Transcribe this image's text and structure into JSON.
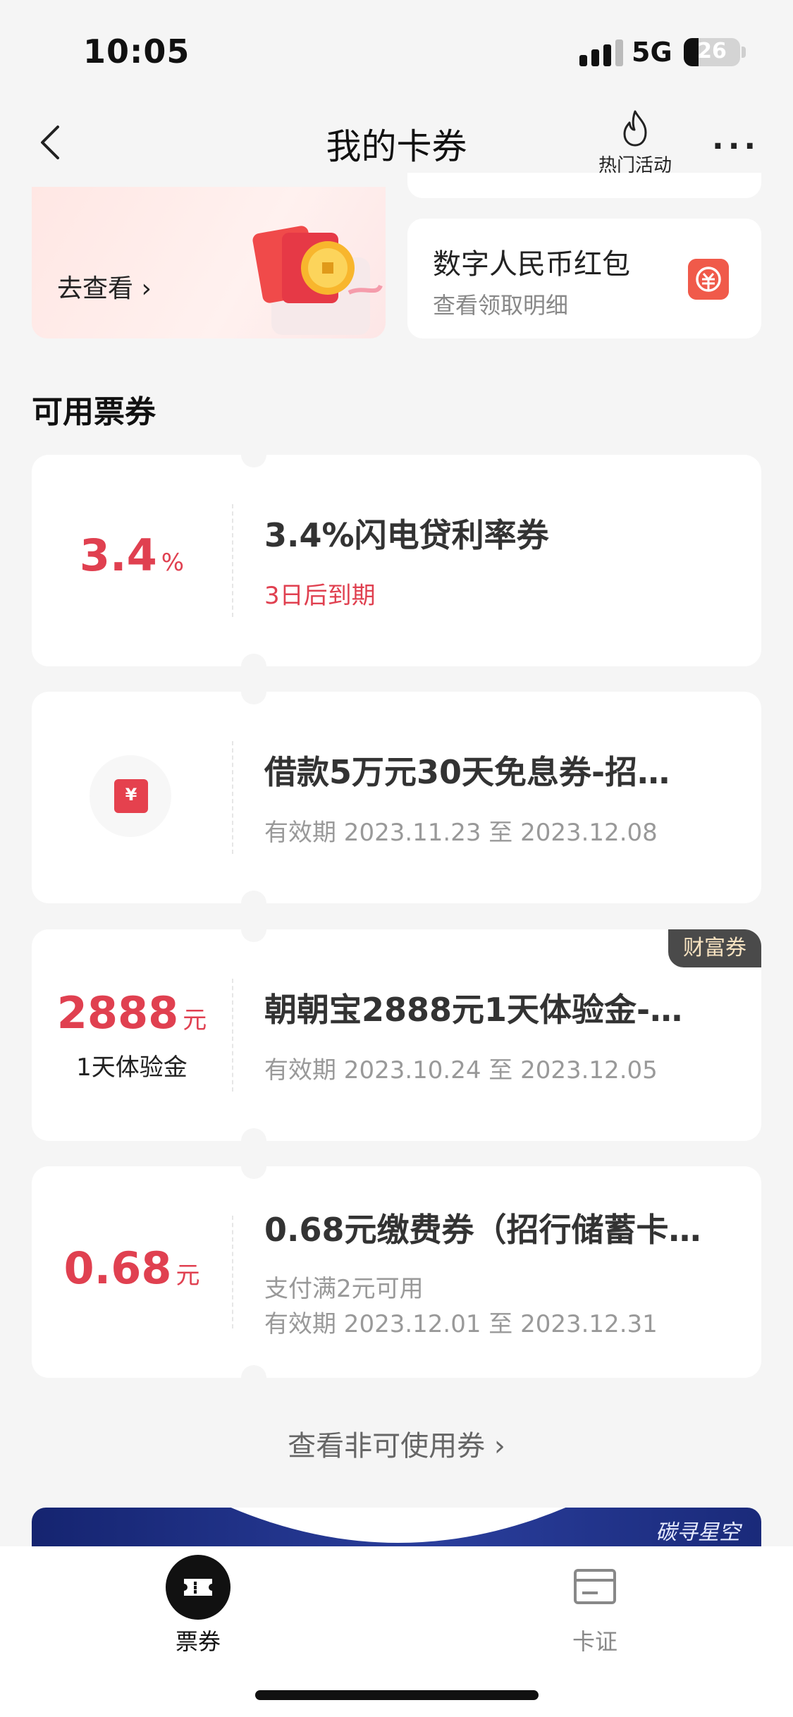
{
  "status_bar": {
    "time": "10:05",
    "network": "5G",
    "battery": "26"
  },
  "nav": {
    "title": "我的卡券",
    "hot_label": "热门活动"
  },
  "banner": {
    "link_label": "去查看 ›"
  },
  "digital_rmb": {
    "title": "数字人民币红包",
    "subtitle": "查看领取明细"
  },
  "section_title": "可用票券",
  "coupons": [
    {
      "value": "3.4",
      "unit": "%",
      "title": "3.4%闪电贷利率券",
      "expiry_note": "3日后到期"
    },
    {
      "title": "借款5万元30天免息券-招…",
      "validity": "有效期 2023.11.23 至 2023.12.08",
      "icon_symbol": "¥"
    },
    {
      "value": "2888",
      "unit": "元",
      "sub": "1天体验金",
      "tag": "财富券",
      "title": "朝朝宝2888元1天体验金-…",
      "validity": "有效期 2023.10.24 至 2023.12.05"
    },
    {
      "value": "0.68",
      "unit": "元",
      "title": "0.68元缴费券（招行储蓄卡…",
      "condition": "支付满2元可用",
      "validity": "有效期 2023.12.01 至 2023.12.31"
    }
  ],
  "view_invalid": "查看非可使用券 ›",
  "promo_text": "碳寻星空",
  "tabs": [
    {
      "label": "票券",
      "active": true
    },
    {
      "label": "卡证",
      "active": false
    }
  ],
  "colors": {
    "accent": "#e04050",
    "background": "#f5f5f5"
  }
}
